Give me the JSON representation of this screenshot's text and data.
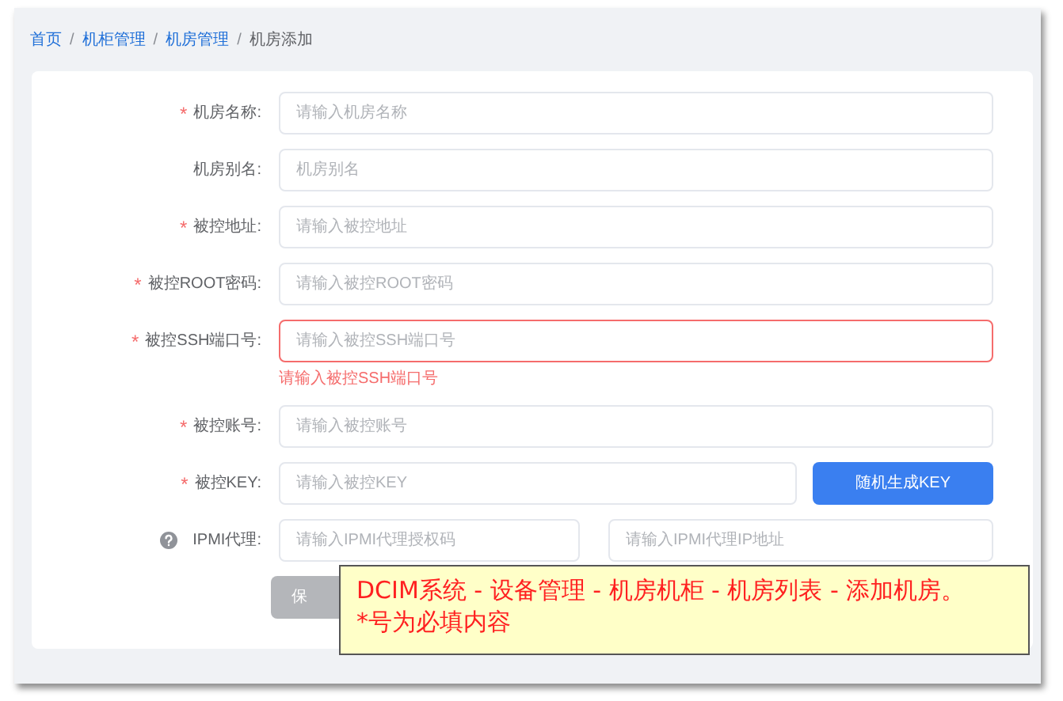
{
  "breadcrumb": [
    {
      "label": "首页",
      "link": true
    },
    {
      "separator": "/",
      "label": "机柜管理",
      "link": true
    },
    {
      "separator": "/",
      "label": "机房管理",
      "link": true
    },
    {
      "separator": "/",
      "label": "机房添加",
      "link": false
    }
  ],
  "fields": [
    {
      "kind": "text",
      "label": "机房名称:",
      "required_mark": "*",
      "placeholder": "请输入机房名称"
    },
    {
      "kind": "text",
      "label": "机房别名:",
      "placeholder": "机房别名"
    },
    {
      "kind": "text",
      "label": "被控地址:",
      "required_mark": "*",
      "placeholder": "请输入被控地址"
    },
    {
      "kind": "text",
      "label": "被控ROOT密码:",
      "required_mark": "*",
      "placeholder": "请输入被控ROOT密码"
    },
    {
      "kind": "text",
      "label": "被控SSH端口号:",
      "required_mark": "*",
      "placeholder": "请输入被控SSH端口号",
      "error": "请输入被控SSH端口号"
    },
    {
      "kind": "text",
      "label": "被控账号:",
      "required_mark": "*",
      "placeholder": "请输入被控账号"
    },
    {
      "kind": "key",
      "label": "被控KEY:",
      "required_mark": "*",
      "placeholder": "请输入被控KEY",
      "button": "随机生成KEY"
    },
    {
      "kind": "pair",
      "label": "IPMI代理:",
      "help": true,
      "placeholder": "请输入IPMI代理授权码",
      "placeholder_2": "请输入IPMI代理IP地址"
    }
  ],
  "save_button": "保",
  "annotation": [
    "DCIM系统 - 设备管理 - 机房机柜 - 机房列表 - 添加机房。",
    "*号为必填内容"
  ]
}
